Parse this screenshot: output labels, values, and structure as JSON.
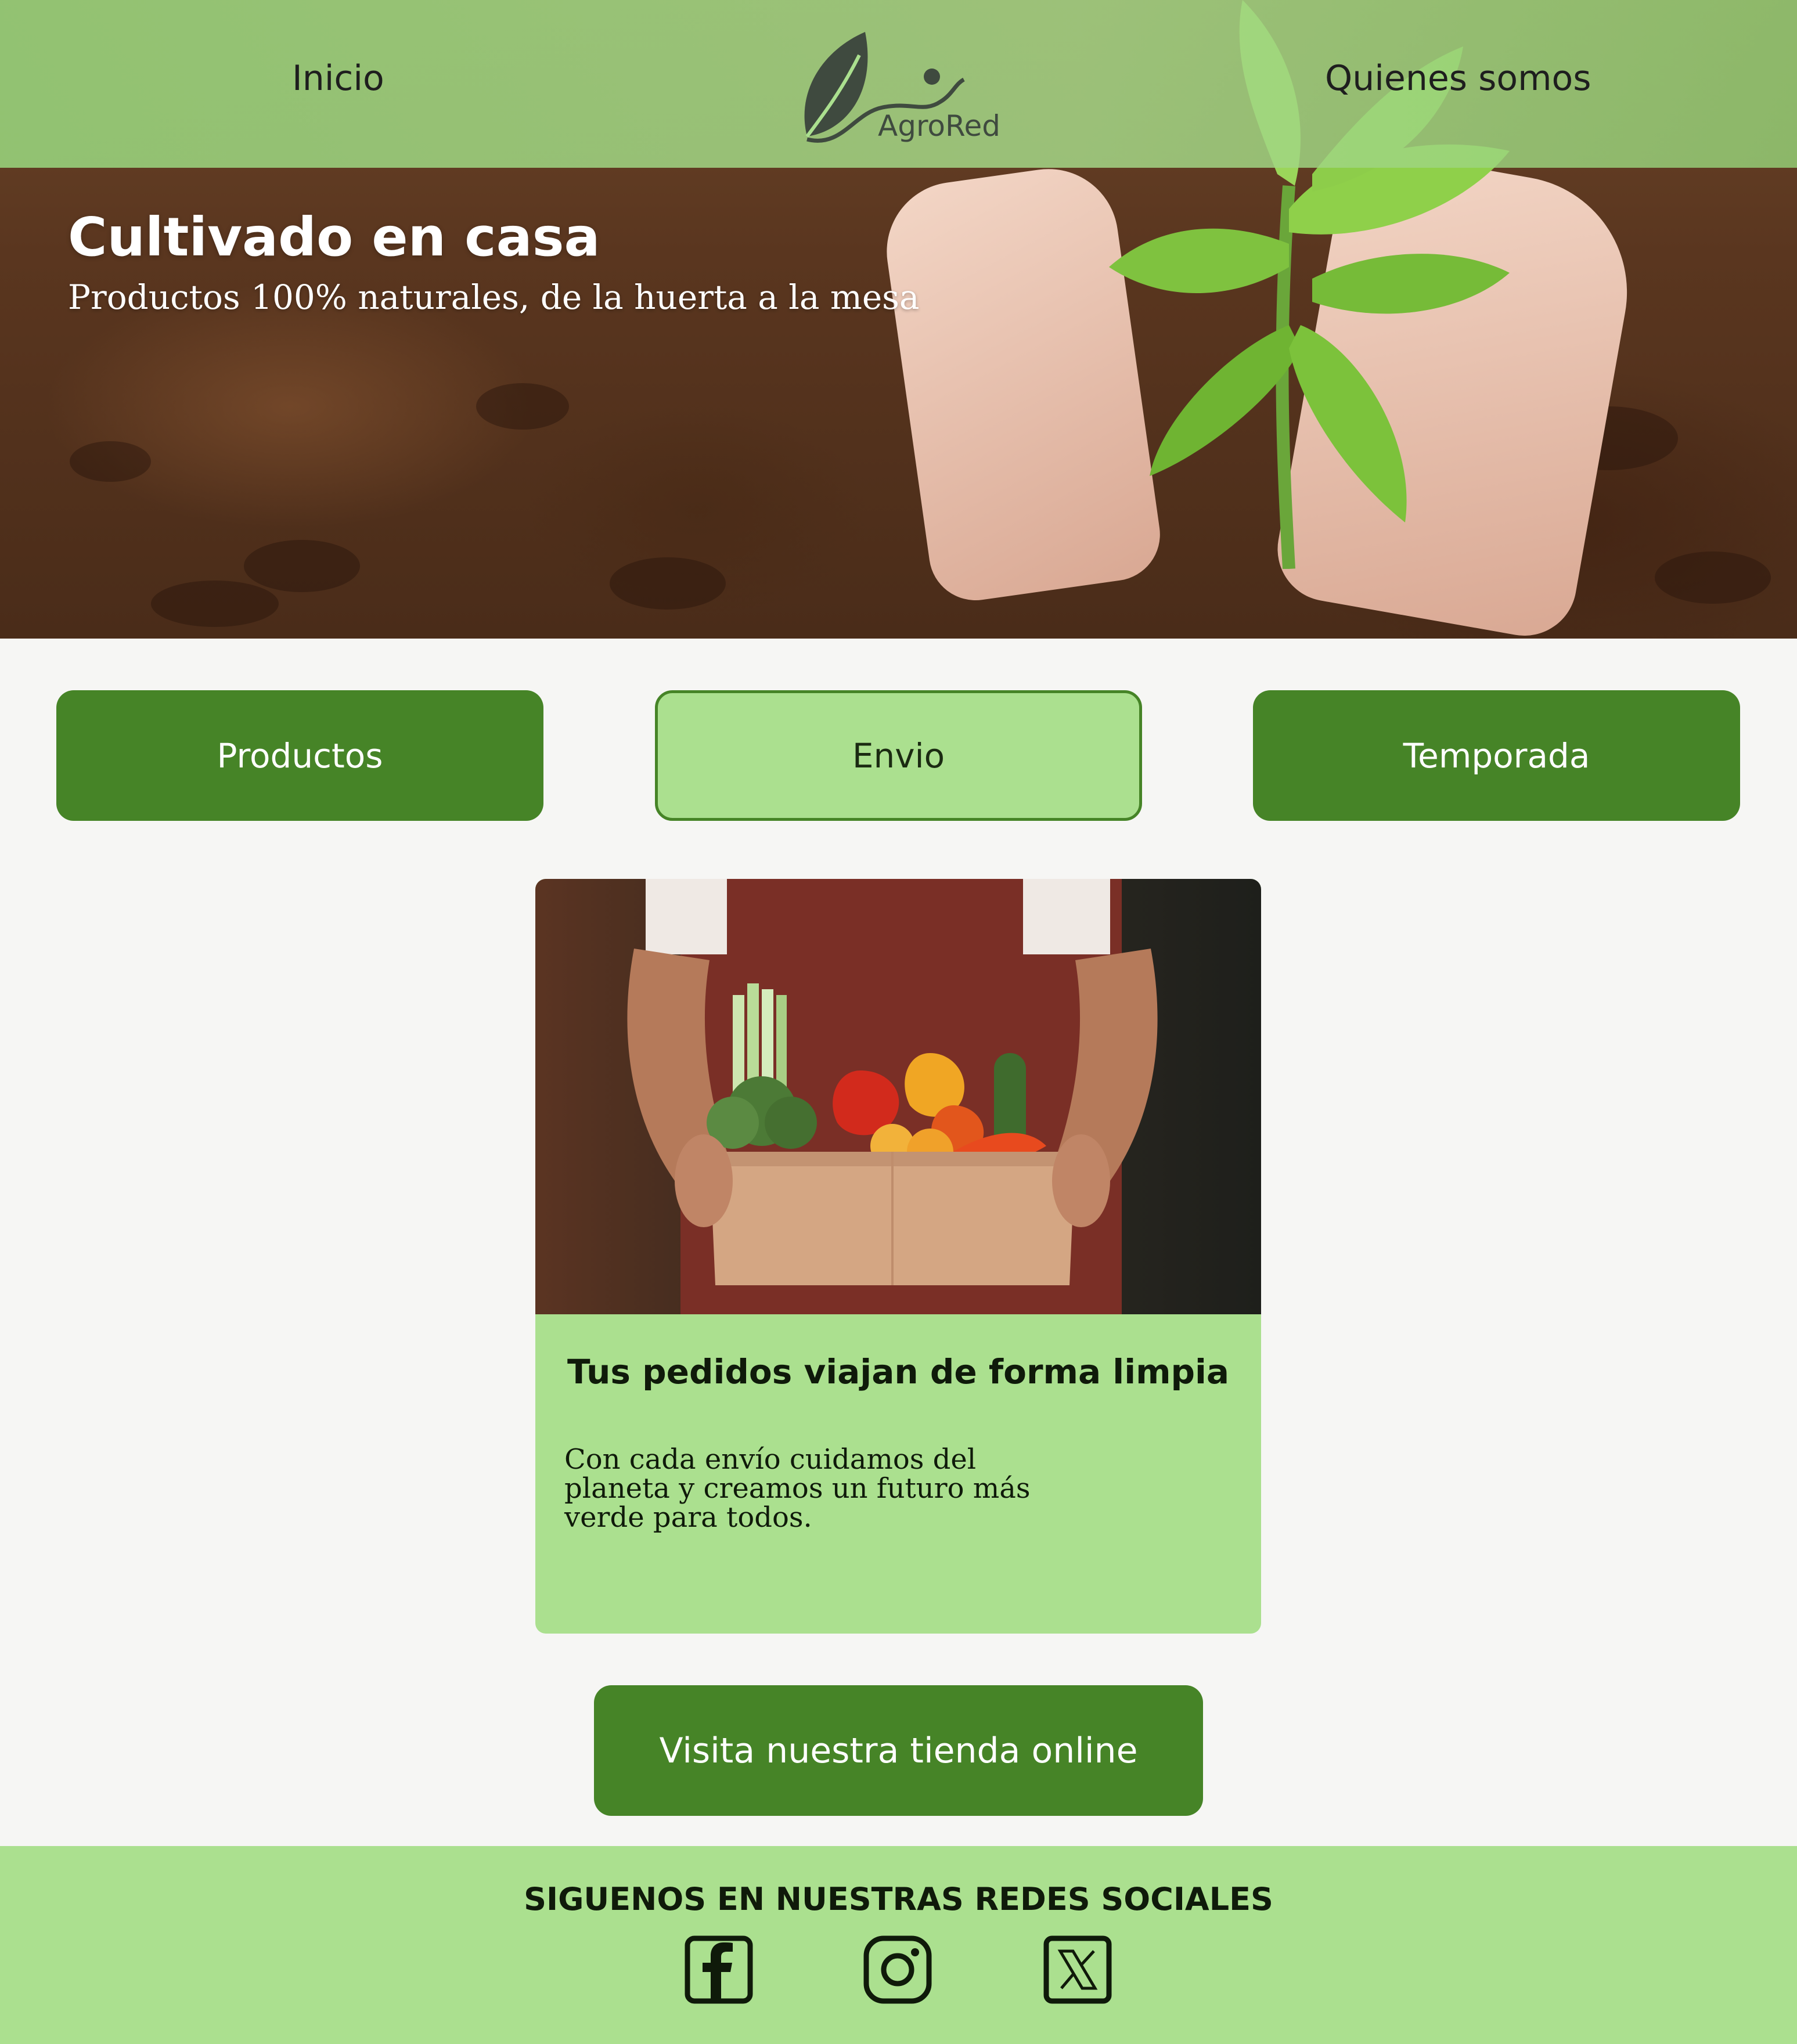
{
  "nav": {
    "left_link": "Inicio",
    "right_link": "Quienes somos",
    "logo_text": "AgroRed"
  },
  "hero": {
    "title": "Cultivado en casa",
    "subtitle": "Productos 100% naturales, de la huerta a la mesa"
  },
  "categories": [
    {
      "label": "Productos",
      "style": "dark"
    },
    {
      "label": "Envio",
      "style": "light",
      "selected": true
    },
    {
      "label": "Temporada",
      "style": "dark"
    }
  ],
  "card": {
    "title": "Tus pedidos viajan de forma limpia",
    "text": "Con cada envío cuidamos del planeta y creamos un futuro más verde para todos."
  },
  "cta": {
    "label": "Visita nuestra  tienda online"
  },
  "footer": {
    "title": "SIGUENOS EN NUESTRAS REDES SOCIALES",
    "socials": [
      {
        "icon": "facebook-icon"
      },
      {
        "icon": "instagram-icon"
      },
      {
        "icon": "x-icon"
      }
    ]
  },
  "colors": {
    "primary_green": "#468427",
    "light_green": "#abe08f",
    "background": "#f6f6f4",
    "text_dark": "#0f1a0a"
  }
}
